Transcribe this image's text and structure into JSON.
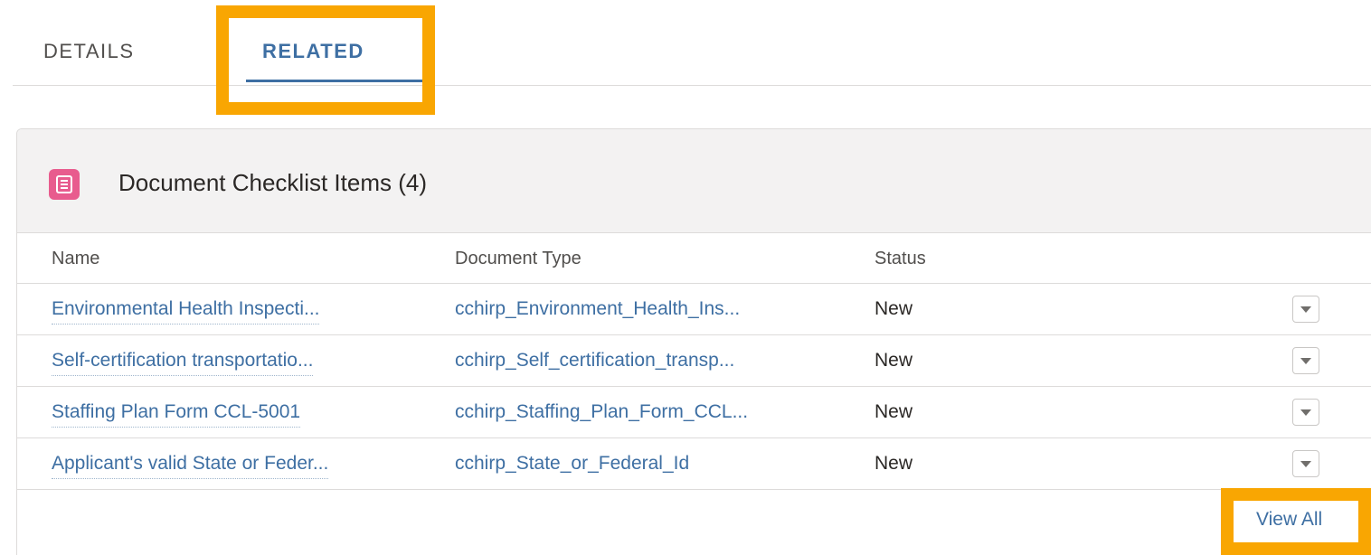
{
  "tabs": {
    "details": "DETAILS",
    "related": "RELATED"
  },
  "card": {
    "icon": "checklist-icon",
    "icon_color": "#e85c8e",
    "title": "Document Checklist Items (4)"
  },
  "table": {
    "headers": {
      "name": "Name",
      "type": "Document Type",
      "status": "Status"
    },
    "rows": [
      {
        "name": "Environmental Health Inspecti...",
        "type": "cchirp_Environment_Health_Ins...",
        "status": "New"
      },
      {
        "name": "Self-certification transportatio...",
        "type": "cchirp_Self_certification_transp...",
        "status": "New"
      },
      {
        "name": "Staffing Plan Form CCL-5001",
        "type": "cchirp_Staffing_Plan_Form_CCL...",
        "status": "New"
      },
      {
        "name": "Applicant's valid State or Feder...",
        "type": "cchirp_State_or_Federal_Id",
        "status": "New"
      }
    ]
  },
  "footer": {
    "view_all": "View All"
  },
  "colors": {
    "link": "#3e6fa3",
    "highlight": "#f9a602"
  }
}
